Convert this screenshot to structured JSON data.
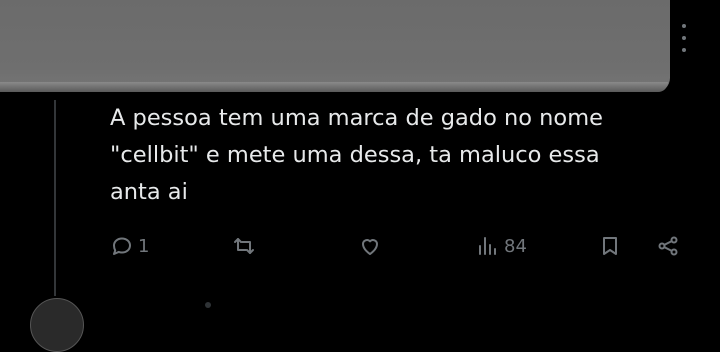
{
  "post": {
    "text": "A pessoa tem uma marca de gado no nome\n\"cellbit\" e mete uma dessa, ta maluco essa\nanta ai"
  },
  "actions": {
    "reply_count": "1",
    "retweet_count": "",
    "like_count": "",
    "views_count": "84"
  },
  "icons": {
    "reply": "reply-icon",
    "retweet": "retweet-icon",
    "like": "heart-icon",
    "views": "views-chart-icon",
    "bookmark": "bookmark-icon",
    "share": "share-icon",
    "more": "more-vertical-icon"
  },
  "colors": {
    "background": "#000000",
    "text": "#e7e9ea",
    "muted": "#71767b"
  }
}
